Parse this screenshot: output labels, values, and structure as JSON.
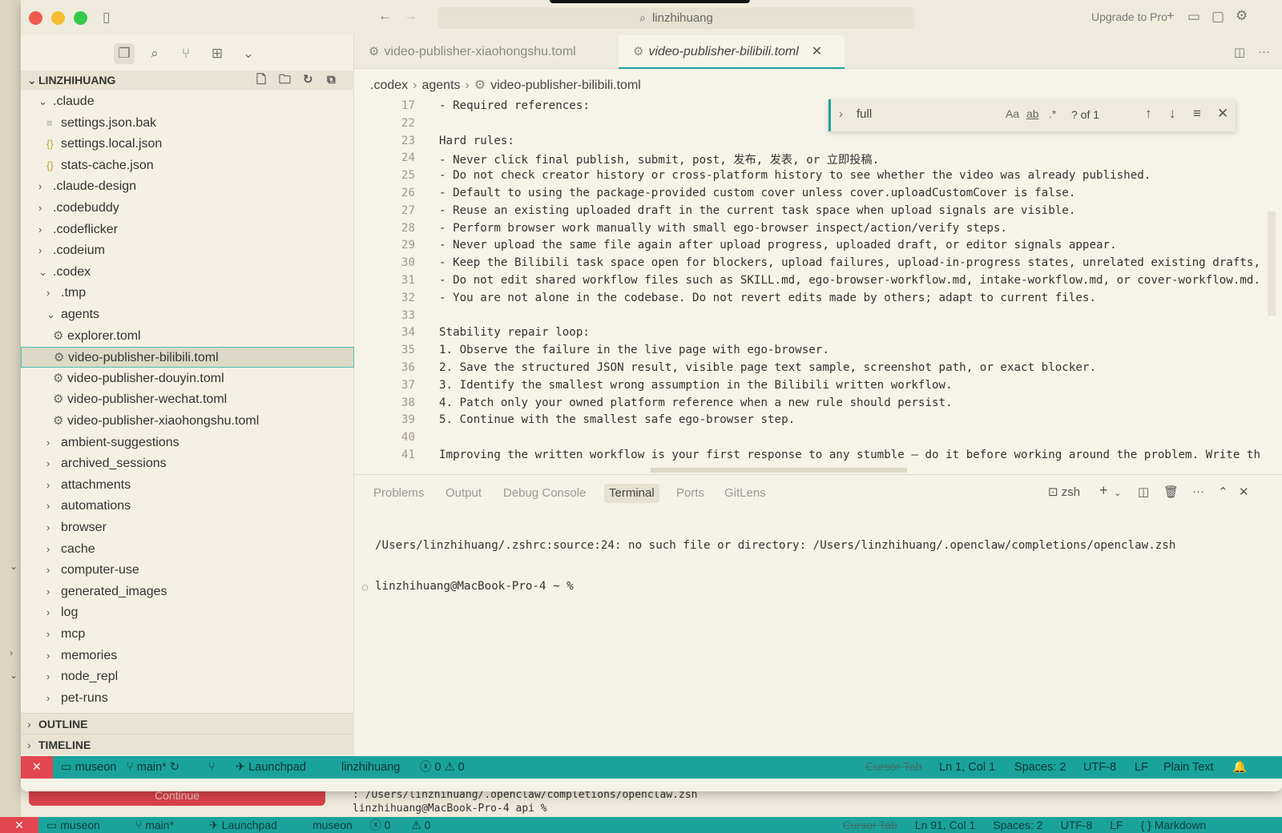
{
  "background_window": {
    "button_label": "Continue",
    "terminal_lines": [
      ": /Users/linzhihuang/.openclaw/completions/openclaw.zsh",
      "linzhihuang@MacBook-Pro-4 api %"
    ],
    "status": {
      "x": "✕",
      "repo": "museon",
      "branch": "main*",
      "launchpad": "Launchpad",
      "user": "museon",
      "problems": "0",
      "warnings": "0",
      "cursor_tab": "Cursor Tab",
      "position": "Ln 91, Col 1",
      "spaces": "Spaces: 2",
      "encoding": "UTF-8",
      "eol": "LF",
      "language": "{ } Markdown"
    }
  },
  "titlebar": {
    "search_text": "linzhihuang",
    "upgrade": "Upgrade to Pro"
  },
  "sidebar": {
    "root": "LINZHIHUANG",
    "tree": [
      {
        "label": ".claude",
        "depth": 1,
        "type": "folder-open"
      },
      {
        "label": "settings.json.bak",
        "depth": 2,
        "type": "file"
      },
      {
        "label": "settings.local.json",
        "depth": 2,
        "type": "json"
      },
      {
        "label": "stats-cache.json",
        "depth": 2,
        "type": "json"
      },
      {
        "label": ".claude-design",
        "depth": 1,
        "type": "folder"
      },
      {
        "label": ".codebuddy",
        "depth": 1,
        "type": "folder"
      },
      {
        "label": ".codeflicker",
        "depth": 1,
        "type": "folder"
      },
      {
        "label": ".codeium",
        "depth": 1,
        "type": "folder"
      },
      {
        "label": ".codex",
        "depth": 1,
        "type": "folder-open"
      },
      {
        "label": ".tmp",
        "depth": 2,
        "type": "folder"
      },
      {
        "label": "agents",
        "depth": 2,
        "type": "folder-open"
      },
      {
        "label": "explorer.toml",
        "depth": 3,
        "type": "toml"
      },
      {
        "label": "video-publisher-bilibili.toml",
        "depth": 3,
        "type": "toml",
        "selected": true
      },
      {
        "label": "video-publisher-douyin.toml",
        "depth": 3,
        "type": "toml"
      },
      {
        "label": "video-publisher-wechat.toml",
        "depth": 3,
        "type": "toml"
      },
      {
        "label": "video-publisher-xiaohongshu.toml",
        "depth": 3,
        "type": "toml"
      },
      {
        "label": "ambient-suggestions",
        "depth": 2,
        "type": "folder"
      },
      {
        "label": "archived_sessions",
        "depth": 2,
        "type": "folder"
      },
      {
        "label": "attachments",
        "depth": 2,
        "type": "folder"
      },
      {
        "label": "automations",
        "depth": 2,
        "type": "folder"
      },
      {
        "label": "browser",
        "depth": 2,
        "type": "folder"
      },
      {
        "label": "cache",
        "depth": 2,
        "type": "folder"
      },
      {
        "label": "computer-use",
        "depth": 2,
        "type": "folder"
      },
      {
        "label": "generated_images",
        "depth": 2,
        "type": "folder"
      },
      {
        "label": "log",
        "depth": 2,
        "type": "folder"
      },
      {
        "label": "mcp",
        "depth": 2,
        "type": "folder"
      },
      {
        "label": "memories",
        "depth": 2,
        "type": "folder"
      },
      {
        "label": "node_repl",
        "depth": 2,
        "type": "folder"
      },
      {
        "label": "pet-runs",
        "depth": 2,
        "type": "folder"
      }
    ],
    "outline": "OUTLINE",
    "timeline": "TIMELINE"
  },
  "editor": {
    "tabs": [
      {
        "label": "video-publisher-xiaohongshu.toml"
      },
      {
        "label": "video-publisher-bilibili.toml",
        "active": true
      }
    ],
    "breadcrumb": [
      ".codex",
      "agents",
      "video-publisher-bilibili.toml"
    ],
    "find": {
      "query": "full",
      "match_case": "Aa",
      "whole_word": "ab",
      "regex": ".*",
      "count": "? of 1"
    },
    "lines": [
      {
        "n": "17",
        "t": "- Required references:"
      },
      {
        "n": "22",
        "t": ""
      },
      {
        "n": "23",
        "t": "Hard rules:"
      },
      {
        "n": "24",
        "t": "- Never click final publish, submit, post, 发布, 发表, or 立即投稿."
      },
      {
        "n": "25",
        "t": "- Do not check creator history or cross-platform history to see whether the video was already published."
      },
      {
        "n": "26",
        "t": "- Default to using the package-provided custom cover unless cover.uploadCustomCover is false."
      },
      {
        "n": "27",
        "t": "- Reuse an existing uploaded draft in the current task space when upload signals are visible."
      },
      {
        "n": "28",
        "t": "- Perform browser work manually with small ego-browser inspect/action/verify steps."
      },
      {
        "n": "29",
        "t": "- Never upload the same file again after upload progress, uploaded draft, or editor signals appear."
      },
      {
        "n": "30",
        "t": "- Keep the Bilibili task space open for blockers, upload failures, upload-in-progress states, unrelated existing drafts,"
      },
      {
        "n": "31",
        "t": "- Do not edit shared workflow files such as SKILL.md, ego-browser-workflow.md, intake-workflow.md, or cover-workflow.md."
      },
      {
        "n": "32",
        "t": "- You are not alone in the codebase. Do not revert edits made by others; adapt to current files."
      },
      {
        "n": "33",
        "t": ""
      },
      {
        "n": "34",
        "t": "Stability repair loop:"
      },
      {
        "n": "35",
        "t": "1. Observe the failure in the live page with ego-browser."
      },
      {
        "n": "36",
        "t": "2. Save the structured JSON result, visible page text sample, screenshot path, or exact blocker."
      },
      {
        "n": "37",
        "t": "3. Identify the smallest wrong assumption in the Bilibili written workflow."
      },
      {
        "n": "38",
        "t": "4. Patch only your owned platform reference when a new rule should persist."
      },
      {
        "n": "39",
        "t": "5. Continue with the smallest safe ego-browser step."
      },
      {
        "n": "40",
        "t": ""
      },
      {
        "n": "41",
        "t": "Improving the written workflow is your first response to any stumble — do it before working around the problem. Write th"
      }
    ]
  },
  "panel": {
    "tabs": [
      "Problems",
      "Output",
      "Debug Console",
      "Terminal",
      "Ports",
      "GitLens"
    ],
    "active_tab": "Terminal",
    "shell": "zsh",
    "terminal_lines": [
      "/Users/linzhihuang/.zshrc:source:24: no such file or directory: /Users/linzhihuang/.openclaw/completions/openclaw.zsh",
      "linzhihuang@MacBook-Pro-4 ~ %"
    ]
  },
  "status": {
    "x": "✕",
    "repo": "museon",
    "branch": "main*",
    "launchpad": "Launchpad",
    "user": "linzhihuang",
    "problems": "0",
    "warnings": "0",
    "cursor_tab": "Cursor Tab",
    "position": "Ln 1, Col 1",
    "spaces": "Spaces: 2",
    "encoding": "UTF-8",
    "eol": "LF",
    "language": "Plain Text"
  },
  "colors": {
    "accent": "#1aa39b",
    "error": "#e2464e",
    "close": "#ee5a52",
    "minimize": "#f5be30",
    "zoom": "#36c84b"
  }
}
